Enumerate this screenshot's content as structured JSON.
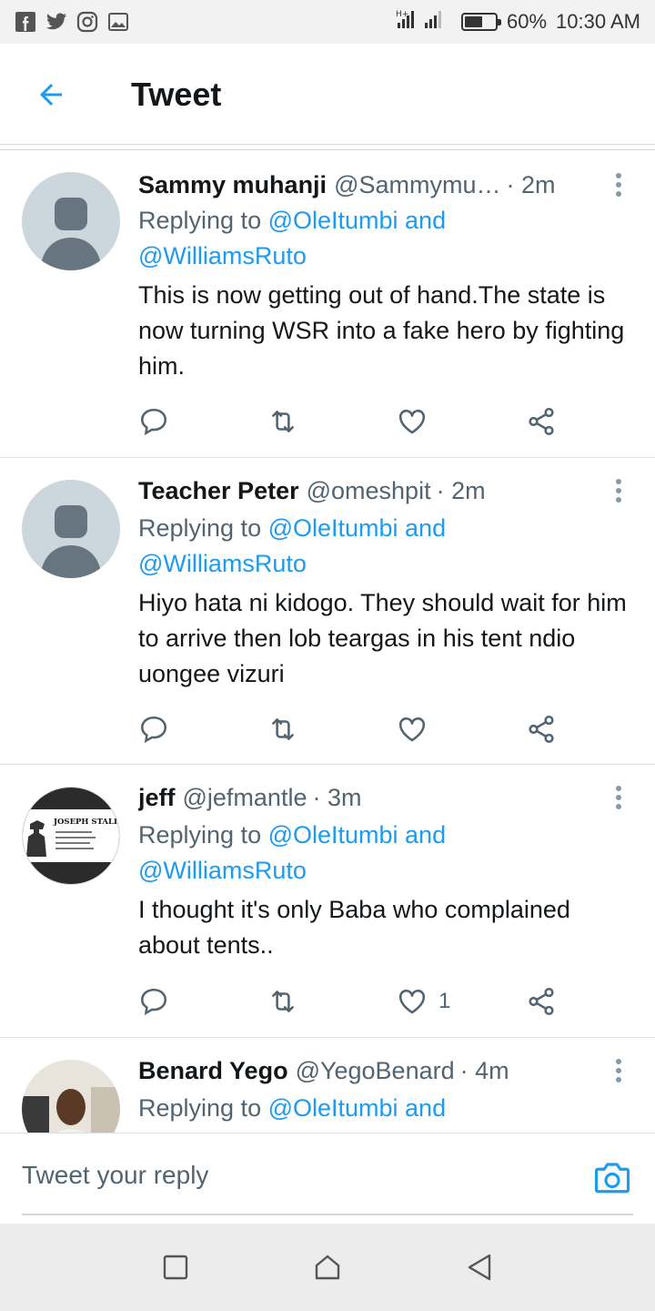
{
  "status_bar": {
    "battery_percent": "60%",
    "time": "10:30 AM",
    "battery_level": 0.6
  },
  "header": {
    "title": "Tweet"
  },
  "colors": {
    "accent": "#1d9bf0",
    "text_primary": "#14171a",
    "text_secondary": "#536471"
  },
  "tweets": [
    {
      "name": "Sammy muhanji",
      "handle": "@Sammymu…",
      "time": "· 2m",
      "replying_prefix": "Replying to ",
      "mention1": "@OleItumbi and",
      "mention2": "@WilliamsRuto",
      "text": "This is now getting out of hand.The state is now turning WSR into a  fake hero by fighting him.",
      "like_count": ""
    },
    {
      "name": "Teacher Peter",
      "handle": "@omeshpit",
      "time": "· 2m",
      "replying_prefix": "Replying to ",
      "mention1": "@OleItumbi and",
      "mention2": "@WilliamsRuto",
      "text": "Hiyo hata ni kidogo. They should wait for him to arrive then lob teargas in his tent ndio uongee vizuri",
      "like_count": ""
    },
    {
      "name": "jeff",
      "handle": "@jefmantle",
      "time": "· 3m",
      "replying_prefix": "Replying to ",
      "mention1": "@OleItumbi and",
      "mention2": "@WilliamsRuto",
      "text": "I thought it's only Baba who complained about tents..",
      "like_count": "1",
      "avatar_caption": "JOSEPH STALIN",
      "avatar_quote": "\"The people who cast the votes decide nothing. The people who count the votes decide everything.\""
    },
    {
      "name": "Benard Yego",
      "handle": "@YegoBenard",
      "time": "· 4m",
      "replying_prefix": "Replying to ",
      "mention1": "@OleItumbi and"
    }
  ],
  "reply_bar": {
    "placeholder": "Tweet your reply"
  }
}
